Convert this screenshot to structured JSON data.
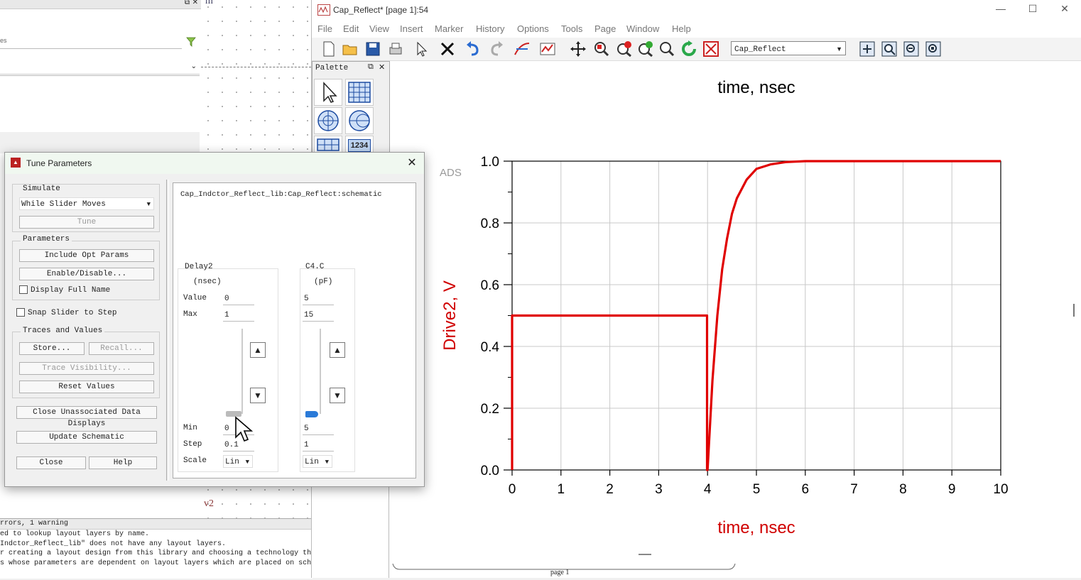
{
  "background_window": {
    "search_placeholder": "es",
    "schematic_fragment": "m",
    "schematic_fragment_bottom": "v2"
  },
  "messages": {
    "header": "rrors, 1 warning",
    "lines": [
      "ed to lookup layout layers by name.",
      "Indctor_Reflect_lib\" does not have any layout layers.",
      "r creating a layout design from this library and choosing a technology th",
      "s whose parameters are dependent on layout layers which are placed on sche"
    ]
  },
  "window": {
    "title": "Cap_Reflect* [page 1]:54",
    "minimize": "—",
    "maximize": "☐",
    "close": "✕"
  },
  "menu": [
    "File",
    "Edit",
    "View",
    "Insert",
    "Marker",
    "History",
    "Options",
    "Tools",
    "Page",
    "Window",
    "Help"
  ],
  "toolbar": {
    "page_combo_value": "Cap_Reflect"
  },
  "palette": {
    "title": "Palette",
    "numeric_label": "1234"
  },
  "plot": {
    "top_title": "time, nsec",
    "watermark": "ADS",
    "page_tab": "page 1"
  },
  "chart_data": {
    "type": "line",
    "xlabel": "time, nsec",
    "ylabel": "Drive2, V",
    "xlim": [
      0,
      10
    ],
    "ylim": [
      0,
      1.0
    ],
    "xticks": [
      0,
      1,
      2,
      3,
      4,
      5,
      6,
      7,
      8,
      9,
      10
    ],
    "yticks": [
      0.0,
      0.2,
      0.4,
      0.6,
      0.8,
      1.0
    ],
    "ytick_labels": [
      "0.0",
      "0.2",
      "0.4",
      "0.6",
      "0.8",
      "1.0"
    ],
    "grid": true,
    "series": [
      {
        "name": "",
        "color": "#e00000",
        "x": [
          0,
          0,
          3.99,
          3.99,
          4.0,
          4.1,
          4.2,
          4.3,
          4.4,
          4.5,
          4.6,
          4.8,
          5.0,
          5.3,
          5.6,
          6.0,
          7.0,
          8.0,
          9.0,
          10.0
        ],
        "y": [
          0,
          0.5,
          0.5,
          0.0,
          0.0,
          0.29,
          0.5,
          0.65,
          0.75,
          0.83,
          0.88,
          0.94,
          0.975,
          0.99,
          0.997,
          1.0,
          1.0,
          1.0,
          1.0,
          1.0
        ]
      }
    ]
  },
  "tune": {
    "title": "Tune Parameters",
    "close": "✕",
    "simulate_label": "Simulate",
    "simulate_mode": "While Slider Moves",
    "tune_button": "Tune",
    "parameters_label": "Parameters",
    "include_opt": "Include Opt Params",
    "enable_disable": "Enable/Disable...",
    "display_full_name": "Display Full Name",
    "snap_slider": "Snap Slider to Step",
    "traces_label": "Traces and Values",
    "store": "Store...",
    "recall": "Recall...",
    "trace_visibility": "Trace Visibility...",
    "reset_values": "Reset Values",
    "close_unassociated": "Close Unassociated Data Displays",
    "update_schematic": "Update Schematic",
    "close_button": "Close",
    "help_button": "Help",
    "schematic_path": "Cap_Indctor_Reflect_lib:Cap_Reflect:schematic",
    "labels": {
      "value": "Value",
      "max": "Max",
      "min": "Min",
      "step": "Step",
      "scale": "Scale"
    },
    "params": [
      {
        "name": "Delay2",
        "unit": "(nsec)",
        "value": "0",
        "max": "1",
        "min": "0",
        "step": "0.1",
        "scale": "Lin",
        "slider_fraction": 0.0
      },
      {
        "name": "C4.C",
        "unit": "(pF)",
        "value": "5",
        "max": "15",
        "min": "5",
        "step": "1",
        "scale": "Lin",
        "slider_fraction": 0.0
      }
    ]
  }
}
